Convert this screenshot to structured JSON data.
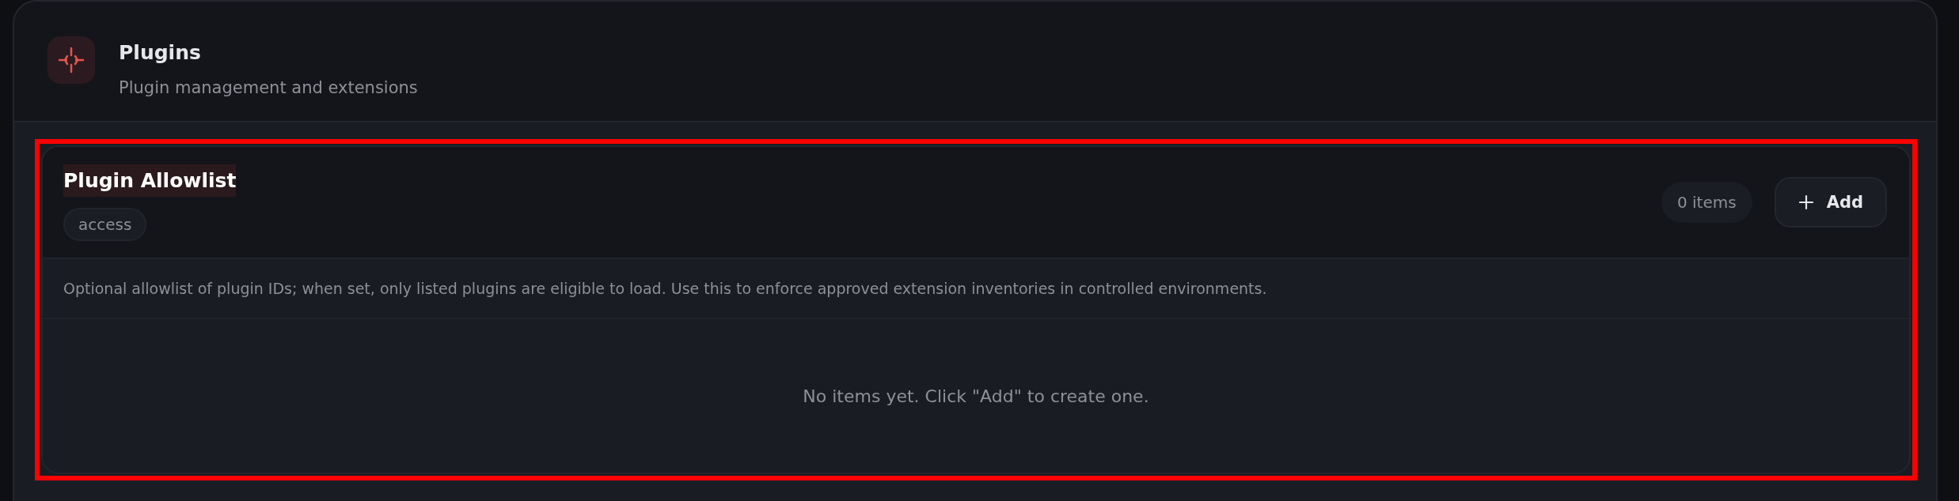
{
  "panel": {
    "title": "Plugins",
    "subtitle": "Plugin management and extensions"
  },
  "section": {
    "highlighted": true,
    "title": "Plugin Allowlist",
    "title_highlighted": true,
    "tag": "access",
    "count": "0 items",
    "add_button": "Add",
    "description": "Optional allowlist of plugin IDs; when set, only listed plugins are eligible to load. Use this to enforce approved extension inventories in controlled environments.",
    "empty_text": "No items yet. Click \"Add\" to create one."
  }
}
